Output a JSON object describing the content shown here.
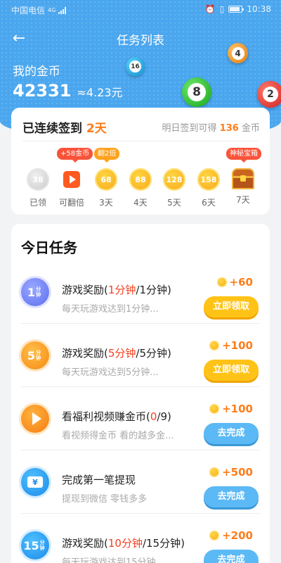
{
  "status_bar": {
    "carrier": "中国电信",
    "network": "4G",
    "time": "10:38"
  },
  "header": {
    "title": "任务列表",
    "back_icon": "arrow-left-icon"
  },
  "coins": {
    "label": "我的金币",
    "amount": "42331",
    "yuan": "≈4.23元"
  },
  "balls": [
    "16",
    "4",
    "8",
    "2"
  ],
  "checkin": {
    "title_prefix": "已连续签到",
    "streak": "2天",
    "hint_prefix": "明日签到可得",
    "hint_amount": "136",
    "hint_suffix": "金币",
    "tags": {
      "double_coins": "+58金币",
      "double_times": "翻2倍",
      "mystery": "神秘宝箱"
    },
    "days": [
      {
        "value": "38",
        "label": "已领",
        "state": "claimed"
      },
      {
        "value": "",
        "label": "可翻倍",
        "state": "video",
        "icon": "play-icon"
      },
      {
        "value": "68",
        "label": "3天",
        "state": "coin"
      },
      {
        "value": "88",
        "label": "4天",
        "state": "coin"
      },
      {
        "value": "128",
        "label": "5天",
        "state": "coin"
      },
      {
        "value": "158",
        "label": "6天",
        "state": "coin"
      },
      {
        "value": "",
        "label": "7天",
        "state": "chest",
        "icon": "treasure-chest-icon"
      }
    ]
  },
  "tasks": {
    "title": "今日任务",
    "items": [
      {
        "name_prefix": "游戏奖励(",
        "name_highlight": "1分钟",
        "name_suffix": "/1分钟)",
        "desc": "每天玩游戏达到1分钟...",
        "reward": "+60",
        "button": "立即领取",
        "icon_text": "1",
        "icon_sub": "分钟"
      },
      {
        "name_prefix": "游戏奖励(",
        "name_highlight": "5分钟",
        "name_suffix": "/5分钟)",
        "desc": "每天玩游戏达到5分钟...",
        "reward": "+100",
        "button": "立即领取",
        "icon_text": "5",
        "icon_sub": "分钟"
      },
      {
        "name_prefix": "看福利视频赚金币(",
        "name_highlight": "0",
        "name_suffix": "/9)",
        "desc": "看视频得金币 看的越多金...",
        "reward": "+100",
        "button": "去完成"
      },
      {
        "name_prefix": "完成第一笔提现",
        "name_highlight": "",
        "name_suffix": "",
        "desc": "提现到微信 零钱多多",
        "reward": "+500",
        "button": "去完成",
        "icon_text": "¥"
      },
      {
        "name_prefix": "游戏奖励(",
        "name_highlight": "10分钟",
        "name_suffix": "/15分钟)",
        "desc": "每天玩游戏达到15分钟...",
        "reward": "+200",
        "button": "去完成",
        "icon_text": "15",
        "icon_sub": "分钟"
      }
    ]
  },
  "colors": {
    "header": "#4aa6ee",
    "accent": "#ff7d1a",
    "button_yellow": "#ffc317",
    "button_blue": "#5bb9f5"
  }
}
